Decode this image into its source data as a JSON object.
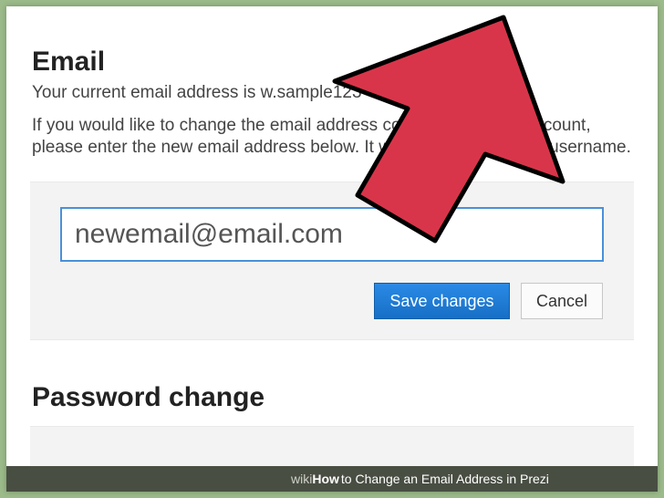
{
  "email_section": {
    "heading": "Email",
    "current_prefix": "Your current email address is ",
    "current_value": "w.sample123",
    "description": "If you would like to change the email address connected to your account, please enter the new email address below. It will also become your username.",
    "input_value": "newemail@email.com",
    "save_label": "Save changes",
    "cancel_label": "Cancel"
  },
  "password_section": {
    "heading": "Password change"
  },
  "caption": {
    "brand_pre": "wiki",
    "brand_bold": "How",
    "title": " to Change an Email Address in Prezi"
  },
  "arrow": {
    "fill": "#d9354a",
    "stroke": "#000000"
  }
}
